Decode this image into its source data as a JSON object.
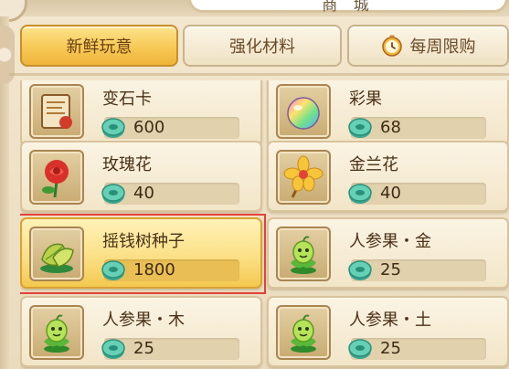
{
  "header": {
    "title": "商 城"
  },
  "tabs": [
    {
      "label": "新鲜玩意",
      "active": true
    },
    {
      "label": "强化材料",
      "active": false
    },
    {
      "label": "每周限购",
      "active": false,
      "icon": "clock-icon"
    }
  ],
  "items": [
    {
      "name": "变石卡",
      "price": "600",
      "icon": "scroll-icon"
    },
    {
      "name": "彩果",
      "price": "68",
      "icon": "rainbow-fruit-icon"
    },
    {
      "name": "玫瑰花",
      "price": "40",
      "icon": "rose-icon"
    },
    {
      "name": "金兰花",
      "price": "40",
      "icon": "golden-orchid-icon"
    },
    {
      "name": "摇钱树种子",
      "price": "1800",
      "icon": "money-tree-seed-icon",
      "selected": true
    },
    {
      "name": "人参果・金",
      "price": "25",
      "icon": "ginseng-fruit-icon"
    },
    {
      "name": "人参果・木",
      "price": "25",
      "icon": "ginseng-fruit-icon"
    },
    {
      "name": "人参果・土",
      "price": "25",
      "icon": "ginseng-fruit-icon"
    }
  ],
  "currency_icon": "jade-coin-icon",
  "colors": {
    "selected_outline": "#e4413b",
    "active_tab": "#f7c956"
  }
}
